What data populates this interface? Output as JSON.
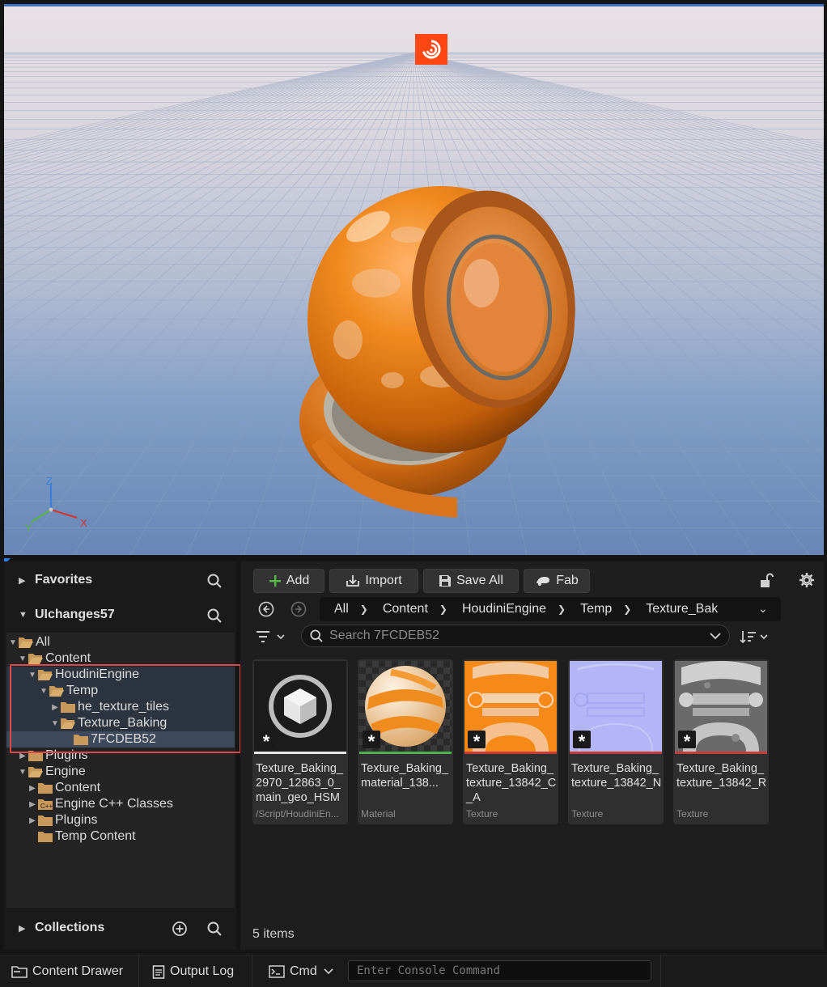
{
  "viewport": {
    "axis_labels": {
      "z": "Z",
      "y": "Y",
      "x": "X"
    }
  },
  "sidebar": {
    "favorites_label": "Favorites",
    "project_label": "UIchanges57",
    "collections_label": "Collections",
    "tree": [
      {
        "label": "All",
        "expanded": true
      },
      {
        "label": "Content",
        "expanded": true
      },
      {
        "label": "HoudiniEngine",
        "expanded": true
      },
      {
        "label": "Temp",
        "expanded": true
      },
      {
        "label": "he_texture_tiles",
        "expanded": false
      },
      {
        "label": "Texture_Baking",
        "expanded": true
      },
      {
        "label": "7FCDEB52",
        "selected": true
      },
      {
        "label": "Plugins",
        "expanded": false
      },
      {
        "label": "Engine",
        "expanded": true
      },
      {
        "label": "Content",
        "expanded": false
      },
      {
        "label": "Engine C++ Classes",
        "expanded": false
      },
      {
        "label": "Plugins",
        "expanded": false
      },
      {
        "label": "Temp Content"
      }
    ]
  },
  "toolbar": {
    "add_label": "Add",
    "import_label": "Import",
    "save_all_label": "Save All",
    "fab_label": "Fab"
  },
  "path": {
    "crumbs": [
      "All",
      "Content",
      "HoudiniEngine",
      "Temp",
      "Texture_Bak"
    ]
  },
  "search": {
    "placeholder": "Search 7FCDEB52"
  },
  "assets": [
    {
      "name": "Texture_Baking_2970_12863_0_main_geo_HSM",
      "type": "/Script/HoudiniEn...",
      "bar_color": "#e8e8e8"
    },
    {
      "name": "Texture_Baking_material_138...",
      "type": "Material",
      "bar_color": "#4caf50"
    },
    {
      "name": "Texture_Baking_texture_13842_C_A",
      "type": "Texture",
      "bar_color": "#c43c3c"
    },
    {
      "name": "Texture_Baking_texture_13842_N",
      "type": "Texture",
      "bar_color": "#c43c3c"
    },
    {
      "name": "Texture_Baking_texture_13842_R",
      "type": "Texture",
      "bar_color": "#c43c3c"
    }
  ],
  "status": {
    "item_count": "5 items"
  },
  "bottom_bar": {
    "content_drawer_label": "Content Drawer",
    "output_log_label": "Output Log",
    "cmd_label": "Cmd",
    "console_placeholder": "Enter Console Command"
  },
  "colors": {
    "accent": "#2f7de1",
    "highlight_box": "#e04848",
    "folder": "#c8995a"
  }
}
